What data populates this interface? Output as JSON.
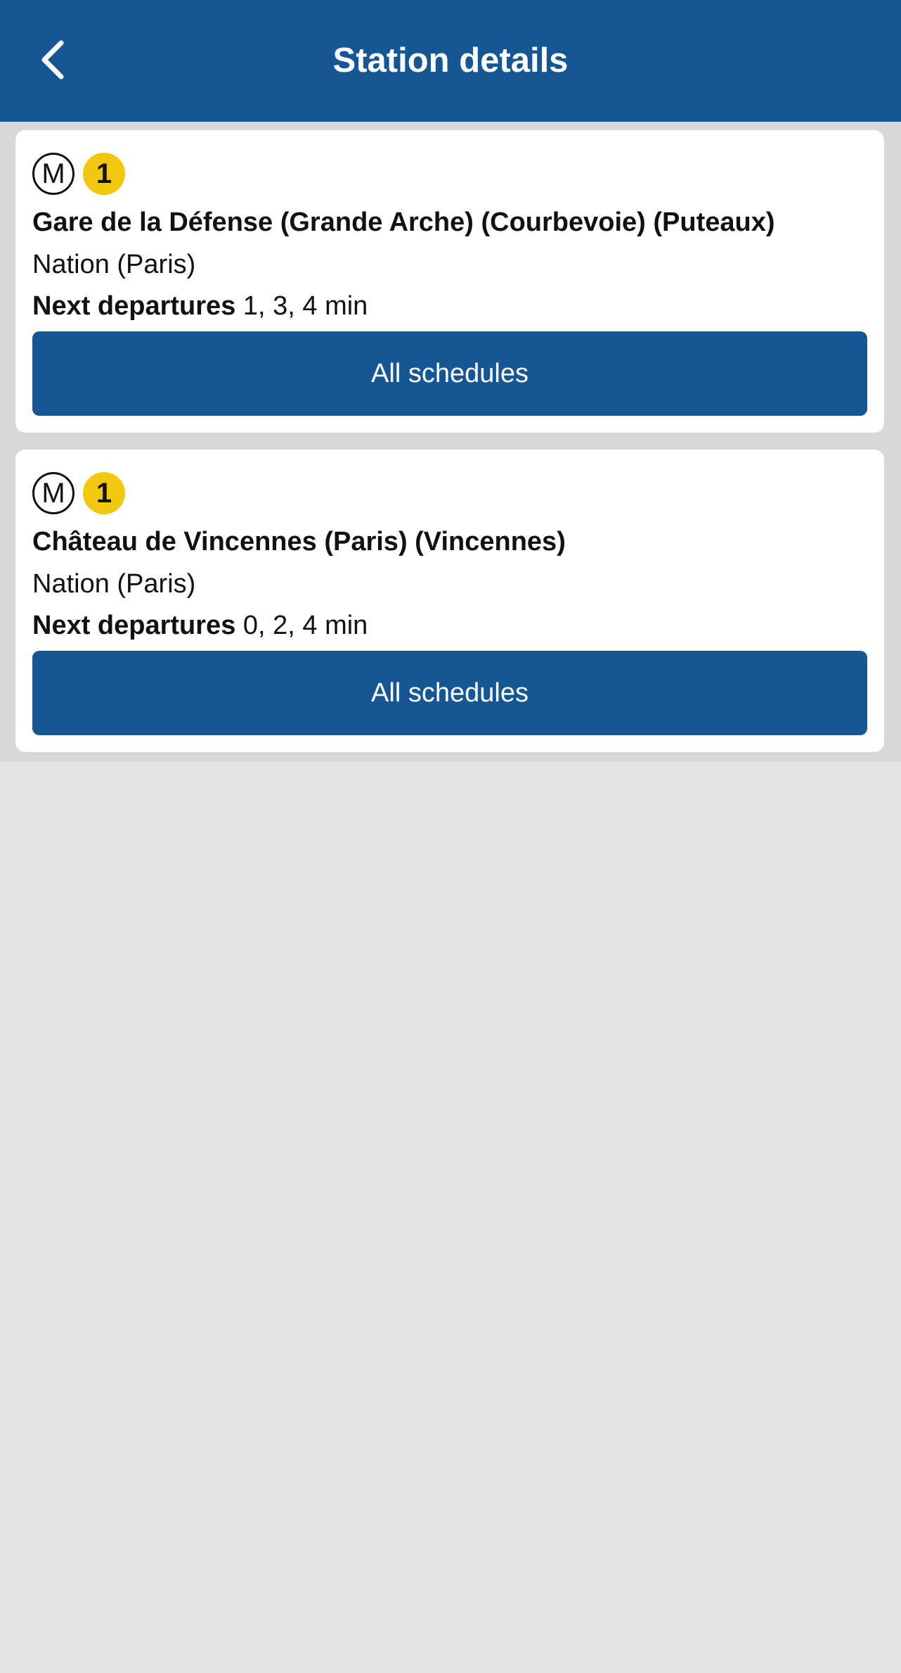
{
  "header": {
    "title": "Station details",
    "back_icon": "chevron-left-icon"
  },
  "colors": {
    "header_bg": "#155694",
    "button_bg": "#155694",
    "line_1": "#f2c80f",
    "background": "#e4e4e4"
  },
  "departures": [
    {
      "mode_badge": "M",
      "line_badge": "1",
      "destination": "Gare de la Défense (Grande Arche) (Courbevoie) (Puteaux)",
      "station": "Nation (Paris)",
      "next_label": "Next departures",
      "next_times": "1, 3, 4 min",
      "button_label": "All schedules"
    },
    {
      "mode_badge": "M",
      "line_badge": "1",
      "destination": "Château de Vincennes (Paris) (Vincennes)",
      "station": "Nation (Paris)",
      "next_label": "Next departures",
      "next_times": "0, 2, 4 min",
      "button_label": "All schedules"
    }
  ]
}
